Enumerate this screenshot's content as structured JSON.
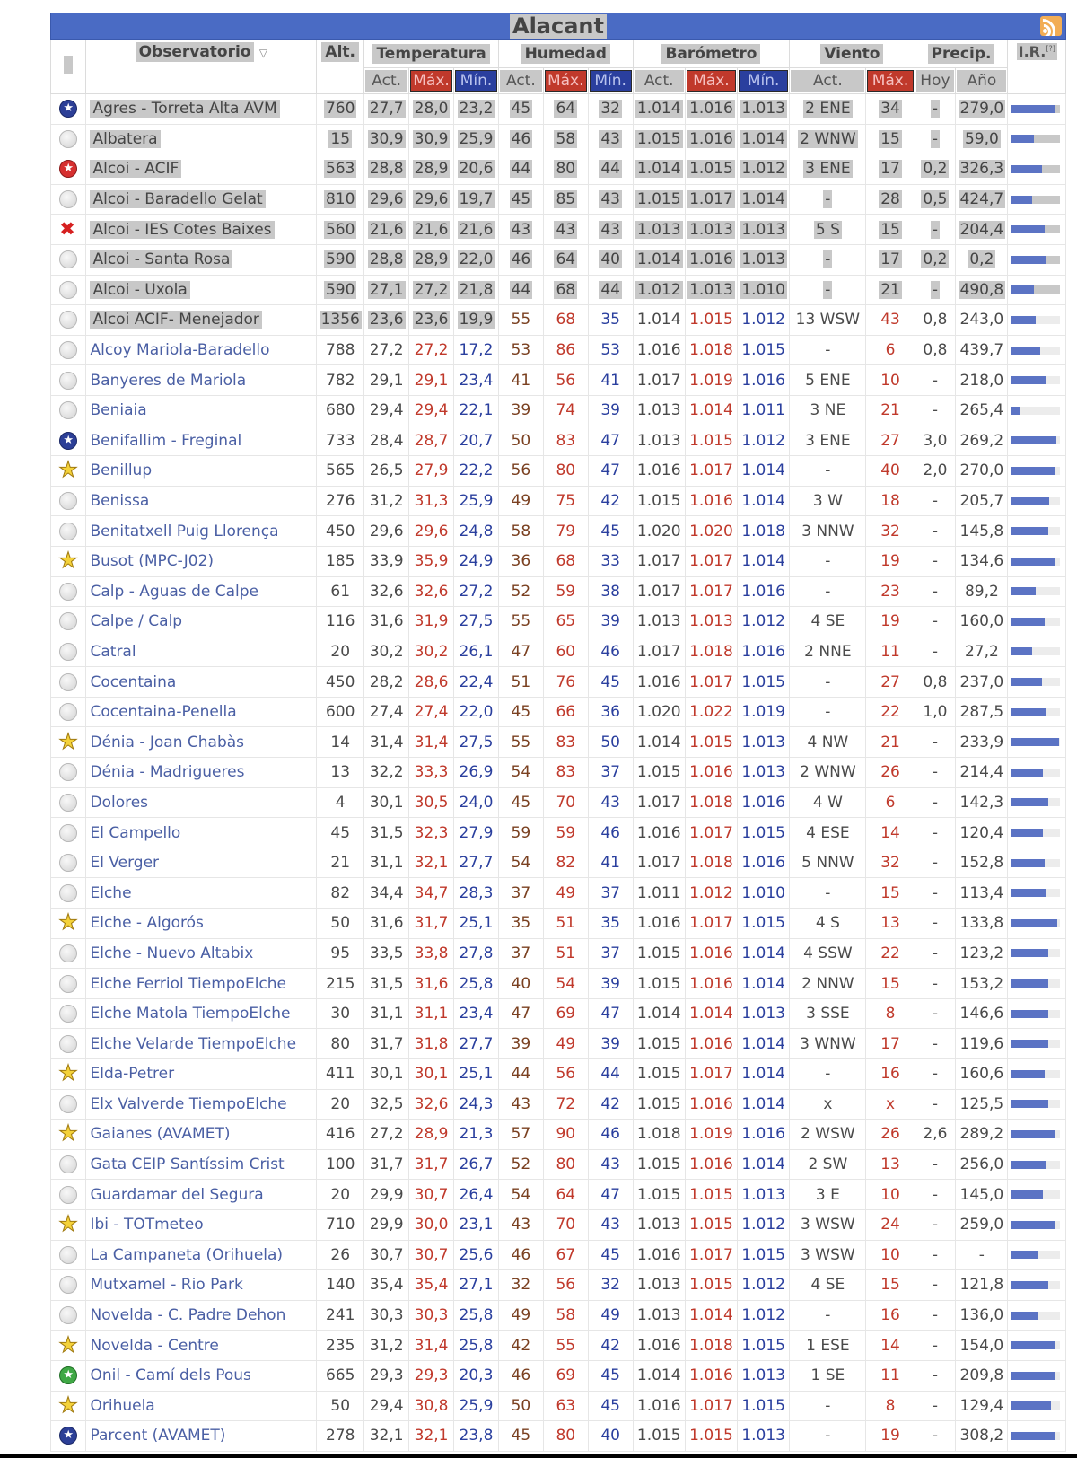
{
  "panel": {
    "title": "Alacant",
    "rss_icon": "rss-icon"
  },
  "headers": {
    "observatorio": "Observatorio",
    "alt": "Alt.",
    "temperatura": "Temperatura",
    "humedad": "Humedad",
    "barometro": "Barómetro",
    "viento": "Viento",
    "precip": "Precip.",
    "ir": "I.R.",
    "ir_sup": "[?]",
    "act": "Act.",
    "max": "Máx.",
    "min": "Mín.",
    "hoy": "Hoy",
    "ano": "Año"
  },
  "colors": {
    "header_bar": "#4a6bc4",
    "max_header": "#c0392b",
    "min_header": "#2a3f9e",
    "link": "#4a5fa4",
    "ir_bar": "#5b73c4"
  },
  "rows": [
    {
      "icon": "blue",
      "name": "Agres - Torreta Alta AVM",
      "alt": "760",
      "t_act": "27,7",
      "t_max": "28,0",
      "t_min": "23,2",
      "h_act": "45",
      "h_max": "64",
      "h_min": "32",
      "b_act": "1.014",
      "b_max": "1.016",
      "b_min": "1.013",
      "v_act": "2 ENE",
      "v_max": "34",
      "p_hoy": "-",
      "p_ano": "279,0",
      "ir": 0.9,
      "grey": true
    },
    {
      "icon": "grey",
      "name": "Albatera",
      "alt": "15",
      "t_act": "30,9",
      "t_max": "30,9",
      "t_min": "25,9",
      "h_act": "46",
      "h_max": "58",
      "h_min": "43",
      "b_act": "1.015",
      "b_max": "1.016",
      "b_min": "1.014",
      "v_act": "2 WNW",
      "v_max": "15",
      "p_hoy": "-",
      "p_ano": "59,0",
      "ir": 0.45,
      "grey": true
    },
    {
      "icon": "red",
      "name": "Alcoi - ACIF",
      "alt": "563",
      "t_act": "28,8",
      "t_max": "28,9",
      "t_min": "20,6",
      "h_act": "44",
      "h_max": "80",
      "h_min": "44",
      "b_act": "1.014",
      "b_max": "1.015",
      "b_min": "1.012",
      "v_act": "3 ENE",
      "v_max": "17",
      "p_hoy": "0,2",
      "p_ano": "326,3",
      "ir": 0.62,
      "grey": true
    },
    {
      "icon": "grey",
      "name": "Alcoi - Baradello Gelat",
      "alt": "810",
      "t_act": "29,6",
      "t_max": "29,6",
      "t_min": "19,7",
      "h_act": "45",
      "h_max": "85",
      "h_min": "43",
      "b_act": "1.015",
      "b_max": "1.017",
      "b_min": "1.014",
      "v_act": "-",
      "v_max": "28",
      "p_hoy": "0,5",
      "p_ano": "424,7",
      "ir": 0.42,
      "grey": true
    },
    {
      "icon": "cross",
      "name": "Alcoi - IES Cotes Baixes",
      "alt": "560",
      "t_act": "21,6",
      "t_max": "21,6",
      "t_min": "21,6",
      "h_act": "43",
      "h_max": "43",
      "h_min": "43",
      "b_act": "1.013",
      "b_max": "1.013",
      "b_min": "1.013",
      "v_act": "5 S",
      "v_max": "15",
      "p_hoy": "-",
      "p_ano": "204,4",
      "ir": 0.68,
      "grey": true
    },
    {
      "icon": "grey",
      "name": "Alcoi - Santa Rosa",
      "alt": "590",
      "t_act": "28,8",
      "t_max": "28,9",
      "t_min": "22,0",
      "h_act": "46",
      "h_max": "64",
      "h_min": "40",
      "b_act": "1.014",
      "b_max": "1.016",
      "b_min": "1.013",
      "v_act": "-",
      "v_max": "17",
      "p_hoy": "0,2",
      "p_ano": "0,2",
      "ir": 0.72,
      "grey": true
    },
    {
      "icon": "grey",
      "name": "Alcoi - Uxola",
      "alt": "590",
      "t_act": "27,1",
      "t_max": "27,2",
      "t_min": "21,8",
      "h_act": "44",
      "h_max": "68",
      "h_min": "44",
      "b_act": "1.012",
      "b_max": "1.013",
      "b_min": "1.010",
      "v_act": "-",
      "v_max": "21",
      "p_hoy": "-",
      "p_ano": "490,8",
      "ir": 0.45,
      "grey": true
    },
    {
      "icon": "grey",
      "name": "Alcoi ACIF- Menejador",
      "alt": "1356",
      "t_act": "23,6",
      "t_max": "23,6",
      "t_min": "19,9",
      "h_act": "55",
      "h_max": "68",
      "h_min": "35",
      "b_act": "1.014",
      "b_max": "1.015",
      "b_min": "1.012",
      "v_act": "13 WSW",
      "v_max": "43",
      "p_hoy": "0,8",
      "p_ano": "243,0",
      "ir": 0.5,
      "grey": "partial"
    },
    {
      "icon": "grey",
      "name": "Alcoy Mariola-Baradello",
      "alt": "788",
      "t_act": "27,2",
      "t_max": "27,2",
      "t_min": "17,2",
      "h_act": "53",
      "h_max": "86",
      "h_min": "53",
      "b_act": "1.016",
      "b_max": "1.018",
      "b_min": "1.015",
      "v_act": "-",
      "v_max": "6",
      "p_hoy": "0,8",
      "p_ano": "439,7",
      "ir": 0.58,
      "grey": false
    },
    {
      "icon": "grey",
      "name": "Banyeres de Mariola",
      "alt": "782",
      "t_act": "29,1",
      "t_max": "29,1",
      "t_min": "23,4",
      "h_act": "41",
      "h_max": "56",
      "h_min": "41",
      "b_act": "1.017",
      "b_max": "1.019",
      "b_min": "1.016",
      "v_act": "5 ENE",
      "v_max": "10",
      "p_hoy": "-",
      "p_ano": "218,0",
      "ir": 0.72,
      "grey": false
    },
    {
      "icon": "grey",
      "name": "Beniaia",
      "alt": "680",
      "t_act": "29,4",
      "t_max": "29,4",
      "t_min": "22,1",
      "h_act": "39",
      "h_max": "74",
      "h_min": "39",
      "b_act": "1.013",
      "b_max": "1.014",
      "b_min": "1.011",
      "v_act": "3 NE",
      "v_max": "21",
      "p_hoy": "-",
      "p_ano": "265,4",
      "ir": 0.18,
      "grey": false
    },
    {
      "icon": "blue",
      "name": "Benifallim - Freginal",
      "alt": "733",
      "t_act": "28,4",
      "t_max": "28,7",
      "t_min": "20,7",
      "h_act": "50",
      "h_max": "83",
      "h_min": "47",
      "b_act": "1.013",
      "b_max": "1.015",
      "b_min": "1.012",
      "v_act": "3 ENE",
      "v_max": "27",
      "p_hoy": "3,0",
      "p_ano": "269,2",
      "ir": 0.92,
      "grey": false
    },
    {
      "icon": "star",
      "name": "Benillup",
      "alt": "565",
      "t_act": "26,5",
      "t_max": "27,9",
      "t_min": "22,2",
      "h_act": "56",
      "h_max": "80",
      "h_min": "47",
      "b_act": "1.016",
      "b_max": "1.017",
      "b_min": "1.014",
      "v_act": "-",
      "v_max": "40",
      "p_hoy": "2,0",
      "p_ano": "270,0",
      "ir": 0.88,
      "grey": false
    },
    {
      "icon": "grey",
      "name": "Benissa",
      "alt": "276",
      "t_act": "31,2",
      "t_max": "31,3",
      "t_min": "25,9",
      "h_act": "49",
      "h_max": "75",
      "h_min": "42",
      "b_act": "1.015",
      "b_max": "1.016",
      "b_min": "1.014",
      "v_act": "3 W",
      "v_max": "18",
      "p_hoy": "-",
      "p_ano": "205,7",
      "ir": 0.78,
      "grey": false
    },
    {
      "icon": "grey",
      "name": "Benitatxell Puig Llorença",
      "alt": "450",
      "t_act": "29,6",
      "t_max": "29,6",
      "t_min": "24,8",
      "h_act": "58",
      "h_max": "79",
      "h_min": "45",
      "b_act": "1.020",
      "b_max": "1.020",
      "b_min": "1.018",
      "v_act": "3 NNW",
      "v_max": "32",
      "p_hoy": "-",
      "p_ano": "145,8",
      "ir": 0.75,
      "grey": false
    },
    {
      "icon": "star",
      "name": "Busot (MPC-J02)",
      "alt": "185",
      "t_act": "33,9",
      "t_max": "35,9",
      "t_min": "24,9",
      "h_act": "36",
      "h_max": "68",
      "h_min": "33",
      "b_act": "1.017",
      "b_max": "1.017",
      "b_min": "1.014",
      "v_act": "-",
      "v_max": "19",
      "p_hoy": "-",
      "p_ano": "134,6",
      "ir": 0.88,
      "grey": false
    },
    {
      "icon": "grey",
      "name": "Calp - Aguas de Calpe",
      "alt": "61",
      "t_act": "32,6",
      "t_max": "32,6",
      "t_min": "27,2",
      "h_act": "52",
      "h_max": "59",
      "h_min": "38",
      "b_act": "1.017",
      "b_max": "1.017",
      "b_min": "1.016",
      "v_act": "-",
      "v_max": "23",
      "p_hoy": "-",
      "p_ano": "89,2",
      "ir": 0.5,
      "grey": false
    },
    {
      "icon": "grey",
      "name": "Calpe / Calp",
      "alt": "116",
      "t_act": "31,6",
      "t_max": "31,9",
      "t_min": "27,5",
      "h_act": "55",
      "h_max": "65",
      "h_min": "39",
      "b_act": "1.013",
      "b_max": "1.013",
      "b_min": "1.012",
      "v_act": "4 SE",
      "v_max": "19",
      "p_hoy": "-",
      "p_ano": "160,0",
      "ir": 0.68,
      "grey": false
    },
    {
      "icon": "grey",
      "name": "Catral",
      "alt": "20",
      "t_act": "30,2",
      "t_max": "30,2",
      "t_min": "26,1",
      "h_act": "47",
      "h_max": "60",
      "h_min": "46",
      "b_act": "1.017",
      "b_max": "1.018",
      "b_min": "1.016",
      "v_act": "2 NNE",
      "v_max": "11",
      "p_hoy": "-",
      "p_ano": "27,2",
      "ir": 0.42,
      "grey": false
    },
    {
      "icon": "grey",
      "name": "Cocentaina",
      "alt": "450",
      "t_act": "28,2",
      "t_max": "28,6",
      "t_min": "22,4",
      "h_act": "51",
      "h_max": "76",
      "h_min": "45",
      "b_act": "1.016",
      "b_max": "1.017",
      "b_min": "1.015",
      "v_act": "-",
      "v_max": "27",
      "p_hoy": "0,8",
      "p_ano": "237,0",
      "ir": 0.62,
      "grey": false
    },
    {
      "icon": "grey",
      "name": "Cocentaina-Penella",
      "alt": "600",
      "t_act": "27,4",
      "t_max": "27,4",
      "t_min": "22,0",
      "h_act": "45",
      "h_max": "66",
      "h_min": "36",
      "b_act": "1.020",
      "b_max": "1.022",
      "b_min": "1.019",
      "v_act": "-",
      "v_max": "22",
      "p_hoy": "1,0",
      "p_ano": "287,5",
      "ir": 0.7,
      "grey": false
    },
    {
      "icon": "star",
      "name": "Dénia - Joan Chabàs",
      "alt": "14",
      "t_act": "31,4",
      "t_max": "31,4",
      "t_min": "27,5",
      "h_act": "55",
      "h_max": "83",
      "h_min": "50",
      "b_act": "1.014",
      "b_max": "1.015",
      "b_min": "1.013",
      "v_act": "4 NW",
      "v_max": "21",
      "p_hoy": "-",
      "p_ano": "233,9",
      "ir": 0.98,
      "grey": false
    },
    {
      "icon": "grey",
      "name": "Dénia - Madrigueres",
      "alt": "13",
      "t_act": "32,2",
      "t_max": "33,3",
      "t_min": "26,9",
      "h_act": "54",
      "h_max": "83",
      "h_min": "37",
      "b_act": "1.015",
      "b_max": "1.016",
      "b_min": "1.013",
      "v_act": "2 WNW",
      "v_max": "26",
      "p_hoy": "-",
      "p_ano": "214,4",
      "ir": 0.65,
      "grey": false
    },
    {
      "icon": "grey",
      "name": "Dolores",
      "alt": "4",
      "t_act": "30,1",
      "t_max": "30,5",
      "t_min": "24,0",
      "h_act": "45",
      "h_max": "70",
      "h_min": "43",
      "b_act": "1.017",
      "b_max": "1.018",
      "b_min": "1.016",
      "v_act": "4 W",
      "v_max": "6",
      "p_hoy": "-",
      "p_ano": "142,3",
      "ir": 0.75,
      "grey": false
    },
    {
      "icon": "grey",
      "name": "El Campello",
      "alt": "45",
      "t_act": "31,5",
      "t_max": "32,3",
      "t_min": "27,9",
      "h_act": "59",
      "h_max": "59",
      "h_min": "46",
      "b_act": "1.016",
      "b_max": "1.017",
      "b_min": "1.015",
      "v_act": "4 ESE",
      "v_max": "14",
      "p_hoy": "-",
      "p_ano": "120,4",
      "ir": 0.65,
      "grey": false
    },
    {
      "icon": "grey",
      "name": "El Verger",
      "alt": "21",
      "t_act": "31,1",
      "t_max": "32,1",
      "t_min": "27,7",
      "h_act": "54",
      "h_max": "82",
      "h_min": "41",
      "b_act": "1.017",
      "b_max": "1.018",
      "b_min": "1.016",
      "v_act": "5 NNW",
      "v_max": "32",
      "p_hoy": "-",
      "p_ano": "152,8",
      "ir": 0.68,
      "grey": false
    },
    {
      "icon": "grey",
      "name": "Elche",
      "alt": "82",
      "t_act": "34,4",
      "t_max": "34,7",
      "t_min": "28,3",
      "h_act": "37",
      "h_max": "49",
      "h_min": "37",
      "b_act": "1.011",
      "b_max": "1.012",
      "b_min": "1.010",
      "v_act": "-",
      "v_max": "15",
      "p_hoy": "-",
      "p_ano": "113,4",
      "ir": 0.72,
      "grey": false
    },
    {
      "icon": "star",
      "name": "Elche - Algorós",
      "alt": "50",
      "t_act": "31,6",
      "t_max": "31,7",
      "t_min": "25,1",
      "h_act": "35",
      "h_max": "51",
      "h_min": "35",
      "b_act": "1.016",
      "b_max": "1.017",
      "b_min": "1.015",
      "v_act": "4 S",
      "v_max": "13",
      "p_hoy": "-",
      "p_ano": "133,8",
      "ir": 0.95,
      "grey": false
    },
    {
      "icon": "grey",
      "name": "Elche - Nuevo Altabix",
      "alt": "95",
      "t_act": "33,5",
      "t_max": "33,8",
      "t_min": "27,8",
      "h_act": "37",
      "h_max": "51",
      "h_min": "37",
      "b_act": "1.015",
      "b_max": "1.016",
      "b_min": "1.014",
      "v_act": "4 SSW",
      "v_max": "22",
      "p_hoy": "-",
      "p_ano": "123,2",
      "ir": 0.75,
      "grey": false
    },
    {
      "icon": "grey",
      "name": "Elche Ferriol TiempoElche",
      "alt": "215",
      "t_act": "31,5",
      "t_max": "31,6",
      "t_min": "25,8",
      "h_act": "40",
      "h_max": "54",
      "h_min": "39",
      "b_act": "1.015",
      "b_max": "1.016",
      "b_min": "1.014",
      "v_act": "2 NNW",
      "v_max": "15",
      "p_hoy": "-",
      "p_ano": "153,2",
      "ir": 0.75,
      "grey": false
    },
    {
      "icon": "grey",
      "name": "Elche Matola TiempoElche",
      "alt": "30",
      "t_act": "31,1",
      "t_max": "31,1",
      "t_min": "23,4",
      "h_act": "47",
      "h_max": "69",
      "h_min": "47",
      "b_act": "1.014",
      "b_max": "1.014",
      "b_min": "1.013",
      "v_act": "3 SSE",
      "v_max": "8",
      "p_hoy": "-",
      "p_ano": "146,6",
      "ir": 0.75,
      "grey": false
    },
    {
      "icon": "grey",
      "name": "Elche Velarde TiempoElche",
      "alt": "80",
      "t_act": "31,7",
      "t_max": "31,8",
      "t_min": "27,7",
      "h_act": "39",
      "h_max": "49",
      "h_min": "39",
      "b_act": "1.015",
      "b_max": "1.016",
      "b_min": "1.014",
      "v_act": "3 WNW",
      "v_max": "17",
      "p_hoy": "-",
      "p_ano": "119,6",
      "ir": 0.75,
      "grey": false
    },
    {
      "icon": "star",
      "name": "Elda-Petrer",
      "alt": "411",
      "t_act": "30,1",
      "t_max": "30,1",
      "t_min": "25,1",
      "h_act": "44",
      "h_max": "56",
      "h_min": "44",
      "b_act": "1.015",
      "b_max": "1.017",
      "b_min": "1.014",
      "v_act": "-",
      "v_max": "16",
      "p_hoy": "-",
      "p_ano": "160,6",
      "ir": 0.68,
      "grey": false
    },
    {
      "icon": "grey",
      "name": "Elx Valverde TiempoElche",
      "alt": "20",
      "t_act": "32,5",
      "t_max": "32,6",
      "t_min": "24,3",
      "h_act": "43",
      "h_max": "72",
      "h_min": "42",
      "b_act": "1.015",
      "b_max": "1.016",
      "b_min": "1.014",
      "v_act": "x",
      "v_max": "x",
      "p_hoy": "-",
      "p_ano": "125,5",
      "ir": 0.75,
      "grey": false
    },
    {
      "icon": "star",
      "name": "Gaianes (AVAMET)",
      "alt": "416",
      "t_act": "27,2",
      "t_max": "28,9",
      "t_min": "21,3",
      "h_act": "57",
      "h_max": "90",
      "h_min": "46",
      "b_act": "1.018",
      "b_max": "1.019",
      "b_min": "1.016",
      "v_act": "2 WSW",
      "v_max": "26",
      "p_hoy": "2,6",
      "p_ano": "289,2",
      "ir": 0.88,
      "grey": false
    },
    {
      "icon": "grey",
      "name": "Gata CEIP Santíssim Crist",
      "alt": "100",
      "t_act": "31,7",
      "t_max": "31,7",
      "t_min": "26,7",
      "h_act": "52",
      "h_max": "80",
      "h_min": "43",
      "b_act": "1.015",
      "b_max": "1.016",
      "b_min": "1.014",
      "v_act": "2 SW",
      "v_max": "13",
      "p_hoy": "-",
      "p_ano": "256,0",
      "ir": 0.72,
      "grey": false
    },
    {
      "icon": "grey",
      "name": "Guardamar del Segura",
      "alt": "20",
      "t_act": "29,9",
      "t_max": "30,7",
      "t_min": "26,4",
      "h_act": "54",
      "h_max": "64",
      "h_min": "47",
      "b_act": "1.015",
      "b_max": "1.015",
      "b_min": "1.013",
      "v_act": "3 E",
      "v_max": "10",
      "p_hoy": "-",
      "p_ano": "145,0",
      "ir": 0.65,
      "grey": false
    },
    {
      "icon": "star",
      "name": "Ibi - TOTmeteo",
      "alt": "710",
      "t_act": "29,9",
      "t_max": "30,0",
      "t_min": "23,1",
      "h_act": "43",
      "h_max": "70",
      "h_min": "43",
      "b_act": "1.013",
      "b_max": "1.015",
      "b_min": "1.012",
      "v_act": "3 WSW",
      "v_max": "24",
      "p_hoy": "-",
      "p_ano": "259,0",
      "ir": 0.9,
      "grey": false
    },
    {
      "icon": "grey",
      "name": "La Campaneta (Orihuela)",
      "alt": "26",
      "t_act": "30,7",
      "t_max": "30,7",
      "t_min": "25,6",
      "h_act": "46",
      "h_max": "67",
      "h_min": "45",
      "b_act": "1.016",
      "b_max": "1.017",
      "b_min": "1.015",
      "v_act": "3 WSW",
      "v_max": "10",
      "p_hoy": "-",
      "p_ano": "-",
      "ir": 0.55,
      "grey": false
    },
    {
      "icon": "grey",
      "name": "Mutxamel - Rio Park",
      "alt": "140",
      "t_act": "35,4",
      "t_max": "35,4",
      "t_min": "27,1",
      "h_act": "32",
      "h_max": "56",
      "h_min": "32",
      "b_act": "1.013",
      "b_max": "1.015",
      "b_min": "1.012",
      "v_act": "4 SE",
      "v_max": "15",
      "p_hoy": "-",
      "p_ano": "121,8",
      "ir": 0.75,
      "grey": false
    },
    {
      "icon": "grey",
      "name": "Novelda - C. Padre Dehon",
      "alt": "241",
      "t_act": "30,3",
      "t_max": "30,3",
      "t_min": "25,8",
      "h_act": "49",
      "h_max": "58",
      "h_min": "49",
      "b_act": "1.013",
      "b_max": "1.014",
      "b_min": "1.012",
      "v_act": "-",
      "v_max": "16",
      "p_hoy": "-",
      "p_ano": "136,0",
      "ir": 0.55,
      "grey": false
    },
    {
      "icon": "star",
      "name": "Novelda - Centre",
      "alt": "235",
      "t_act": "31,2",
      "t_max": "31,4",
      "t_min": "25,8",
      "h_act": "42",
      "h_max": "55",
      "h_min": "42",
      "b_act": "1.016",
      "b_max": "1.018",
      "b_min": "1.015",
      "v_act": "1 ESE",
      "v_max": "14",
      "p_hoy": "-",
      "p_ano": "154,0",
      "ir": 0.9,
      "grey": false
    },
    {
      "icon": "green",
      "name": "Onil - Camí dels Pous",
      "alt": "665",
      "t_act": "29,3",
      "t_max": "29,3",
      "t_min": "20,3",
      "h_act": "46",
      "h_max": "69",
      "h_min": "45",
      "b_act": "1.014",
      "b_max": "1.016",
      "b_min": "1.013",
      "v_act": "1 SE",
      "v_max": "11",
      "p_hoy": "-",
      "p_ano": "209,8",
      "ir": 0.88,
      "grey": false
    },
    {
      "icon": "star",
      "name": "Orihuela",
      "alt": "50",
      "t_act": "29,4",
      "t_max": "30,8",
      "t_min": "25,9",
      "h_act": "50",
      "h_max": "63",
      "h_min": "45",
      "b_act": "1.016",
      "b_max": "1.017",
      "b_min": "1.015",
      "v_act": "-",
      "v_max": "8",
      "p_hoy": "-",
      "p_ano": "129,4",
      "ir": 0.82,
      "grey": false
    },
    {
      "icon": "blue",
      "name": "Parcent (AVAMET)",
      "alt": "278",
      "t_act": "32,1",
      "t_max": "32,1",
      "t_min": "23,8",
      "h_act": "45",
      "h_max": "80",
      "h_min": "40",
      "b_act": "1.015",
      "b_max": "1.015",
      "b_min": "1.013",
      "v_act": "-",
      "v_max": "19",
      "p_hoy": "-",
      "p_ano": "308,2",
      "ir": 0.88,
      "grey": false
    }
  ]
}
